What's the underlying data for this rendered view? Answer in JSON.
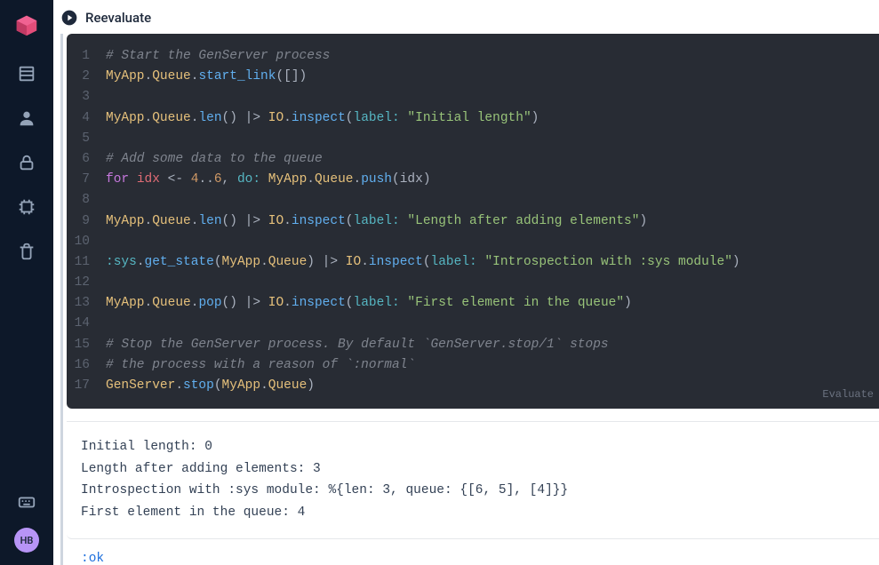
{
  "sidebar": {
    "avatar_initials": "HB"
  },
  "toolbar": {
    "reevaluate_label": "Reevaluate",
    "evaluated_hint": "Evaluate"
  },
  "code": {
    "lines": [
      {
        "n": "1",
        "tokens": [
          {
            "c": "tok-comment",
            "t": "# Start the GenServer process"
          }
        ]
      },
      {
        "n": "2",
        "tokens": [
          {
            "c": "tok-module",
            "t": "MyApp"
          },
          {
            "c": "tok-punc",
            "t": "."
          },
          {
            "c": "tok-module",
            "t": "Queue"
          },
          {
            "c": "tok-punc",
            "t": "."
          },
          {
            "c": "tok-func",
            "t": "start_link"
          },
          {
            "c": "tok-punc",
            "t": "([])"
          }
        ]
      },
      {
        "n": "3",
        "tokens": [
          {
            "c": "tok-punc",
            "t": ""
          }
        ]
      },
      {
        "n": "4",
        "tokens": [
          {
            "c": "tok-module",
            "t": "MyApp"
          },
          {
            "c": "tok-punc",
            "t": "."
          },
          {
            "c": "tok-module",
            "t": "Queue"
          },
          {
            "c": "tok-punc",
            "t": "."
          },
          {
            "c": "tok-func",
            "t": "len"
          },
          {
            "c": "tok-punc",
            "t": "() |> "
          },
          {
            "c": "tok-module",
            "t": "IO"
          },
          {
            "c": "tok-punc",
            "t": "."
          },
          {
            "c": "tok-func",
            "t": "inspect"
          },
          {
            "c": "tok-punc",
            "t": "("
          },
          {
            "c": "tok-atom",
            "t": "label:"
          },
          {
            "c": "tok-punc",
            "t": " "
          },
          {
            "c": "tok-str",
            "t": "\"Initial length\""
          },
          {
            "c": "tok-punc",
            "t": ")"
          }
        ]
      },
      {
        "n": "5",
        "tokens": [
          {
            "c": "tok-punc",
            "t": ""
          }
        ]
      },
      {
        "n": "6",
        "tokens": [
          {
            "c": "tok-comment",
            "t": "# Add some data to the queue"
          }
        ]
      },
      {
        "n": "7",
        "tokens": [
          {
            "c": "tok-kw",
            "t": "for"
          },
          {
            "c": "tok-punc",
            "t": " "
          },
          {
            "c": "tok-var",
            "t": "idx"
          },
          {
            "c": "tok-punc",
            "t": " <- "
          },
          {
            "c": "tok-num",
            "t": "4"
          },
          {
            "c": "tok-punc",
            "t": ".."
          },
          {
            "c": "tok-num",
            "t": "6"
          },
          {
            "c": "tok-punc",
            "t": ", "
          },
          {
            "c": "tok-atom",
            "t": "do:"
          },
          {
            "c": "tok-punc",
            "t": " "
          },
          {
            "c": "tok-module",
            "t": "MyApp"
          },
          {
            "c": "tok-punc",
            "t": "."
          },
          {
            "c": "tok-module",
            "t": "Queue"
          },
          {
            "c": "tok-punc",
            "t": "."
          },
          {
            "c": "tok-func",
            "t": "push"
          },
          {
            "c": "tok-punc",
            "t": "(idx)"
          }
        ]
      },
      {
        "n": "8",
        "tokens": [
          {
            "c": "tok-punc",
            "t": ""
          }
        ]
      },
      {
        "n": "9",
        "tokens": [
          {
            "c": "tok-module",
            "t": "MyApp"
          },
          {
            "c": "tok-punc",
            "t": "."
          },
          {
            "c": "tok-module",
            "t": "Queue"
          },
          {
            "c": "tok-punc",
            "t": "."
          },
          {
            "c": "tok-func",
            "t": "len"
          },
          {
            "c": "tok-punc",
            "t": "() |> "
          },
          {
            "c": "tok-module",
            "t": "IO"
          },
          {
            "c": "tok-punc",
            "t": "."
          },
          {
            "c": "tok-func",
            "t": "inspect"
          },
          {
            "c": "tok-punc",
            "t": "("
          },
          {
            "c": "tok-atom",
            "t": "label:"
          },
          {
            "c": "tok-punc",
            "t": " "
          },
          {
            "c": "tok-str",
            "t": "\"Length after adding elements\""
          },
          {
            "c": "tok-punc",
            "t": ")"
          }
        ]
      },
      {
        "n": "10",
        "tokens": [
          {
            "c": "tok-punc",
            "t": ""
          }
        ]
      },
      {
        "n": "11",
        "tokens": [
          {
            "c": "tok-atom",
            "t": ":sys"
          },
          {
            "c": "tok-punc",
            "t": "."
          },
          {
            "c": "tok-func",
            "t": "get_state"
          },
          {
            "c": "tok-punc",
            "t": "("
          },
          {
            "c": "tok-module",
            "t": "MyApp"
          },
          {
            "c": "tok-punc",
            "t": "."
          },
          {
            "c": "tok-module",
            "t": "Queue"
          },
          {
            "c": "tok-punc",
            "t": ") |> "
          },
          {
            "c": "tok-module",
            "t": "IO"
          },
          {
            "c": "tok-punc",
            "t": "."
          },
          {
            "c": "tok-func",
            "t": "inspect"
          },
          {
            "c": "tok-punc",
            "t": "("
          },
          {
            "c": "tok-atom",
            "t": "label:"
          },
          {
            "c": "tok-punc",
            "t": " "
          },
          {
            "c": "tok-str",
            "t": "\"Introspection with :sys module\""
          },
          {
            "c": "tok-punc",
            "t": ")"
          }
        ]
      },
      {
        "n": "12",
        "tokens": [
          {
            "c": "tok-punc",
            "t": ""
          }
        ]
      },
      {
        "n": "13",
        "tokens": [
          {
            "c": "tok-module",
            "t": "MyApp"
          },
          {
            "c": "tok-punc",
            "t": "."
          },
          {
            "c": "tok-module",
            "t": "Queue"
          },
          {
            "c": "tok-punc",
            "t": "."
          },
          {
            "c": "tok-func",
            "t": "pop"
          },
          {
            "c": "tok-punc",
            "t": "() |> "
          },
          {
            "c": "tok-module",
            "t": "IO"
          },
          {
            "c": "tok-punc",
            "t": "."
          },
          {
            "c": "tok-func",
            "t": "inspect"
          },
          {
            "c": "tok-punc",
            "t": "("
          },
          {
            "c": "tok-atom",
            "t": "label:"
          },
          {
            "c": "tok-punc",
            "t": " "
          },
          {
            "c": "tok-str",
            "t": "\"First element in the queue\""
          },
          {
            "c": "tok-punc",
            "t": ")"
          }
        ]
      },
      {
        "n": "14",
        "tokens": [
          {
            "c": "tok-punc",
            "t": ""
          }
        ]
      },
      {
        "n": "15",
        "tokens": [
          {
            "c": "tok-comment",
            "t": "# Stop the GenServer process. By default `GenServer.stop/1` stops"
          }
        ]
      },
      {
        "n": "16",
        "tokens": [
          {
            "c": "tok-comment",
            "t": "# the process with a reason of `:normal`"
          }
        ]
      },
      {
        "n": "17",
        "tokens": [
          {
            "c": "tok-module",
            "t": "GenServer"
          },
          {
            "c": "tok-punc",
            "t": "."
          },
          {
            "c": "tok-func",
            "t": "stop"
          },
          {
            "c": "tok-punc",
            "t": "("
          },
          {
            "c": "tok-module",
            "t": "MyApp"
          },
          {
            "c": "tok-punc",
            "t": "."
          },
          {
            "c": "tok-module",
            "t": "Queue"
          },
          {
            "c": "tok-punc",
            "t": ")"
          }
        ]
      }
    ]
  },
  "output": {
    "lines": [
      "Initial length: 0",
      "Length after adding elements: 3",
      "Introspection with :sys module: %{len: 3, queue: {[6, 5], [4]}}",
      "First element in the queue: 4"
    ],
    "result": ":ok"
  }
}
